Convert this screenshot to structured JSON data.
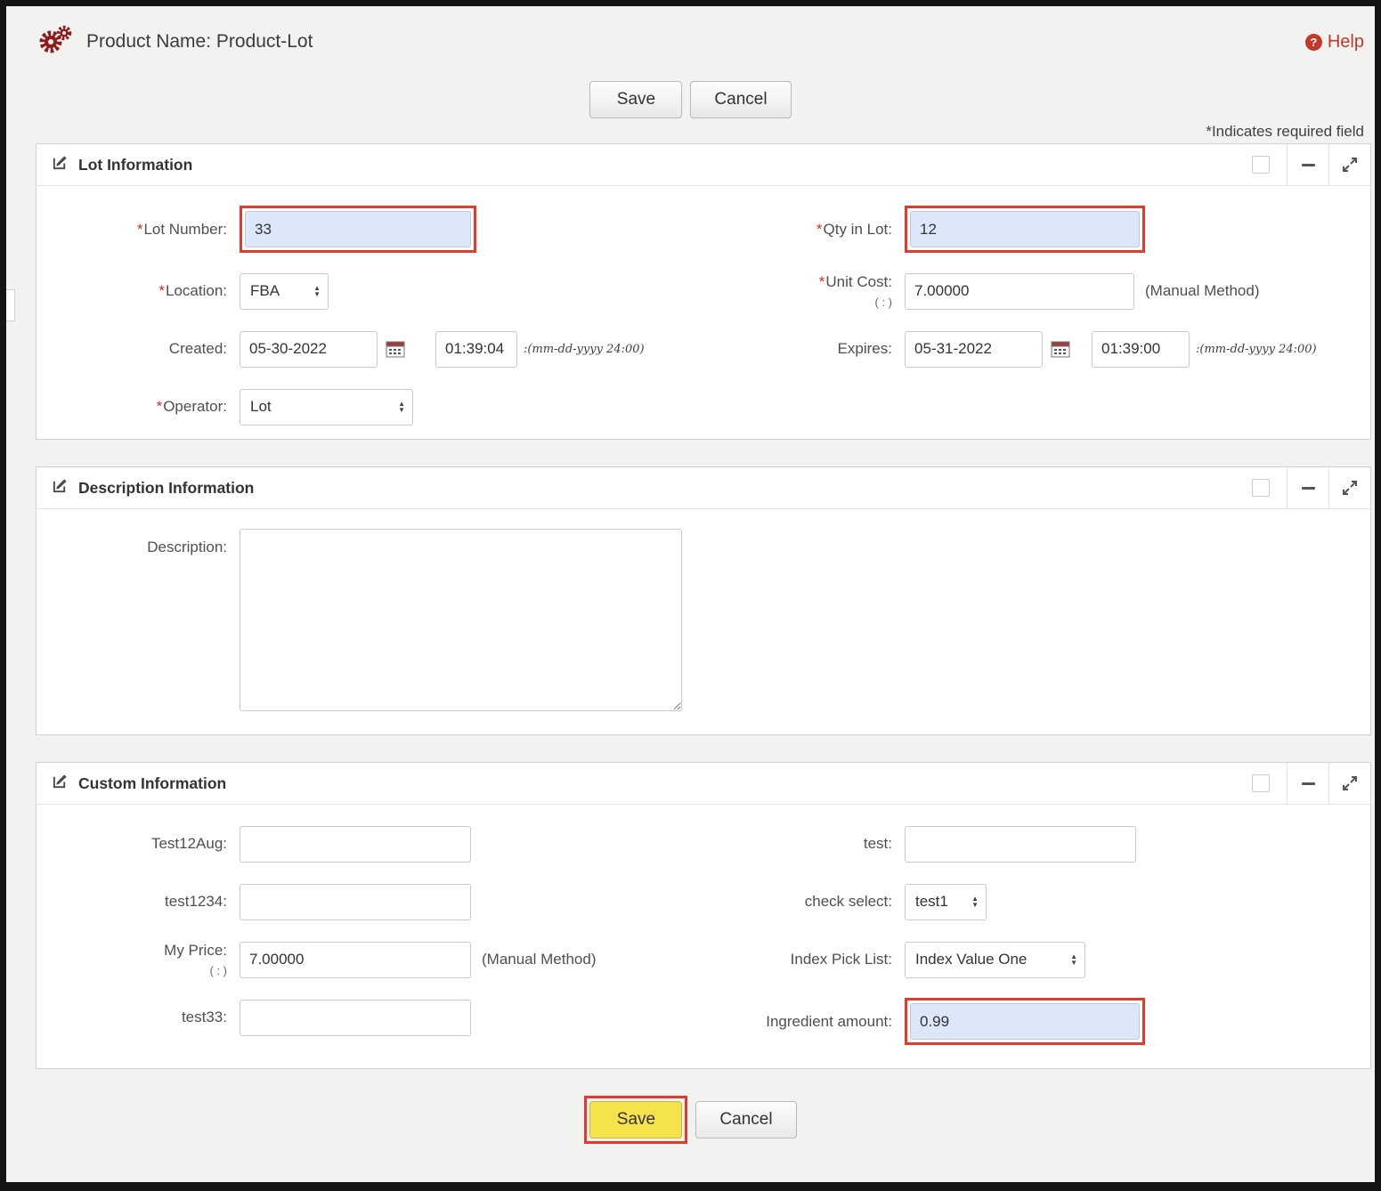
{
  "page": {
    "required_marker": "*",
    "header": {
      "title": "Product Name: Product-Lot",
      "help": "Help"
    },
    "required_note": "*Indicates required field",
    "buttons": {
      "save": "Save",
      "cancel": "Cancel"
    }
  },
  "lot_panel": {
    "title": "Lot Information",
    "lot_number": {
      "label": "Lot Number:",
      "value": "33"
    },
    "location": {
      "label": "Location:",
      "value": "FBA"
    },
    "created": {
      "label": "Created:",
      "date": "05-30-2022",
      "time": "01:39:04",
      "hint": ":(mm-dd-yyyy 24:00)"
    },
    "operator": {
      "label": "Operator:",
      "value": "Lot"
    },
    "qty_in_lot": {
      "label": "Qty in Lot:",
      "value": "12"
    },
    "unit_cost": {
      "label": "Unit Cost:",
      "sub": "( : )",
      "value": "7.00000",
      "method": "(Manual Method)"
    },
    "expires": {
      "label": "Expires:",
      "date": "05-31-2022",
      "time": "01:39:00",
      "hint": ":(mm-dd-yyyy 24:00)"
    }
  },
  "description_panel": {
    "title": "Description Information",
    "description": {
      "label": "Description:",
      "value": ""
    }
  },
  "custom_panel": {
    "title": "Custom Information",
    "test12aug": {
      "label": "Test12Aug:",
      "value": ""
    },
    "test1234": {
      "label": "test1234:",
      "value": ""
    },
    "my_price": {
      "label": "My Price:",
      "sub": "( : )",
      "value": "7.00000",
      "method": "(Manual Method)"
    },
    "test33": {
      "label": "test33:",
      "value": ""
    },
    "test": {
      "label": "test:",
      "value": ""
    },
    "check_select": {
      "label": "check select:",
      "value": "test1"
    },
    "index_pick_list": {
      "label": "Index Pick List:",
      "value": "Index Value One"
    },
    "ingredient_amount": {
      "label": "Ingredient amount:",
      "value": "0.99"
    }
  },
  "footer": {
    "save": "Save",
    "cancel": "Cancel"
  }
}
